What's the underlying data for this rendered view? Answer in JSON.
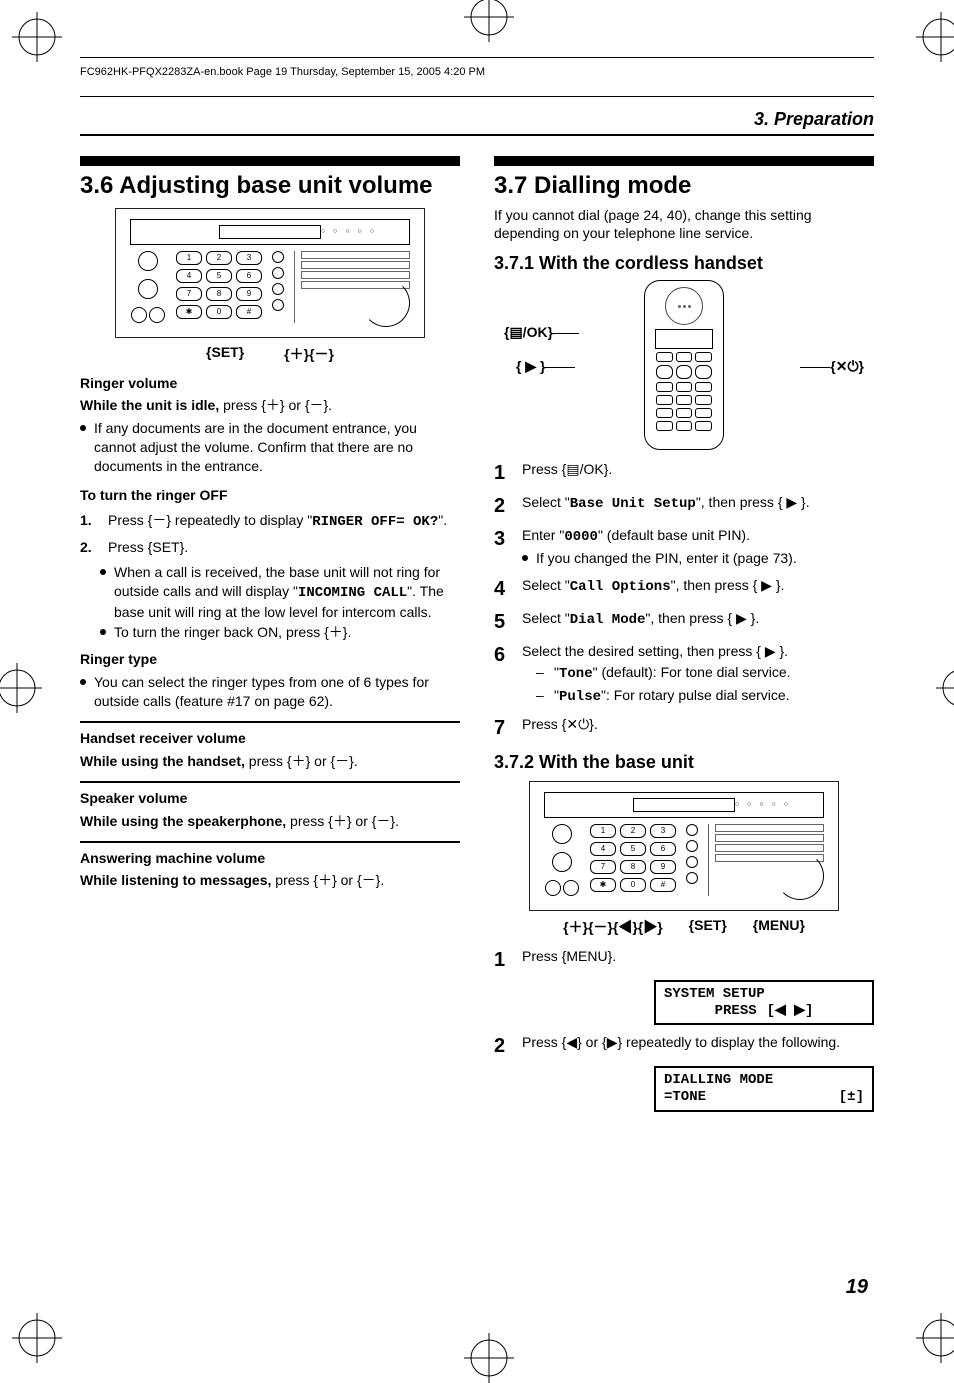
{
  "header": {
    "book_info": "FC962HK-PFQX2283ZA-en.book  Page 19  Thursday, September 15, 2005  4:20 PM"
  },
  "chapter": {
    "title": "3. Preparation"
  },
  "left": {
    "title": "3.6 Adjusting base unit volume",
    "figure_caption": {
      "set": "{SET}",
      "plusminus": "{＋}{－}"
    },
    "ringer_volume": {
      "heading": "Ringer volume",
      "while_idle": "While the unit is idle, ",
      "press_text": "press {＋} or {－}.",
      "bullet1": "If any documents are in the document entrance, you cannot adjust the volume. Confirm that there are no documents in the entrance."
    },
    "ringer_off": {
      "heading": "To turn the ringer OFF",
      "step1_a": "Press {－} repeatedly to display \"",
      "step1_code": "RINGER OFF= OK?",
      "step1_b": "\".",
      "step2": "Press {SET}.",
      "bullet1a": "When a call is received, the base unit will not ring for outside calls and will display \"",
      "bullet1code": "INCOMING CALL",
      "bullet1b": "\". The base unit will ring at the low level for intercom calls.",
      "bullet2": "To turn the ringer back ON, press {＋}."
    },
    "ringer_type": {
      "heading": "Ringer type",
      "bullet": "You can select the ringer types from one of 6 types for outside calls (feature #17 on page 62)."
    },
    "handset_volume": {
      "heading": "Handset receiver volume",
      "line_a": "While using the handset, ",
      "line_b": "press {＋} or {－}."
    },
    "speaker_volume": {
      "heading": "Speaker volume",
      "line_a": "While using the speakerphone, ",
      "line_b": "press {＋} or {－}."
    },
    "am_volume": {
      "heading": "Answering machine volume",
      "line_a": "While listening to messages, ",
      "line_b": "press {＋} or {－}."
    }
  },
  "right": {
    "title": "3.7 Dialling mode",
    "intro": "If you cannot dial (page 24, 40), change this setting depending on your telephone line service.",
    "s1_title": "3.7.1 With the cordless handset",
    "hs_labels": {
      "menu_ok": "{▤/OK}",
      "right": "{ ▶ }",
      "off": "{✕⏻}"
    },
    "steps1": {
      "s1": "Press {▤/OK}.",
      "s2a": "Select \"",
      "s2code": "Base Unit Setup",
      "s2b": "\", then press { ▶ }.",
      "s3a": "Enter \"",
      "s3code": "0000",
      "s3b": "\" (default base unit PIN).",
      "s3bullet": "If you changed the PIN, enter it (page 73).",
      "s4a": "Select \"",
      "s4code": "Call Options",
      "s4b": "\", then press { ▶ }.",
      "s5a": "Select \"",
      "s5code": "Dial Mode",
      "s5b": "\", then press { ▶ }.",
      "s6": "Select the desired setting, then press { ▶ }.",
      "s6d1a": "\"",
      "s6d1code": "Tone",
      "s6d1b": "\" (default): For tone dial service.",
      "s6d2a": "\"",
      "s6d2code": "Pulse",
      "s6d2b": "\": For rotary pulse dial service.",
      "s7": "Press {✕⏻}."
    },
    "s2_title": "3.7.2 With the base unit",
    "figure2_caption": {
      "left": "{＋}{－}{◀}{▶}",
      "set": "{SET}",
      "menu": "{MENU}"
    },
    "steps2": {
      "s1": "Press {MENU}.",
      "lcd1_l1": "SYSTEM SETUP",
      "lcd1_l2a": "PRESS",
      "lcd1_l2b": "[◀ ▶]",
      "s2": "Press {◀} or {▶} repeatedly to display the following.",
      "lcd2_l1": "DIALLING MODE",
      "lcd2_l2a": "=TONE",
      "lcd2_l2b": "[±]"
    }
  },
  "page_number": "19"
}
